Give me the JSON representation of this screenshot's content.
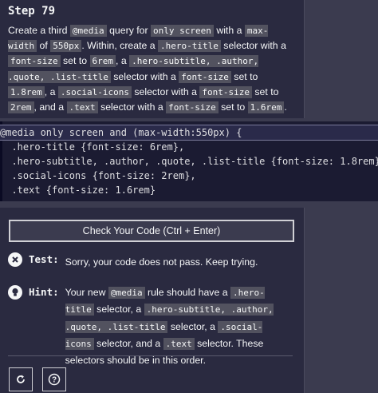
{
  "step": {
    "title": "Step 79"
  },
  "description": {
    "t1": "Create a third ",
    "c1": "@media",
    "t2": " query for ",
    "c2": "only screen",
    "t3": " with a ",
    "c3": "max-width",
    "t4": " of ",
    "c4": "550px",
    "t5": ". Within, create a ",
    "c5": ".hero-title",
    "t6": " selector with a ",
    "c6": "font-size",
    "t7": " set to ",
    "c7": "6rem",
    "t8": ", a ",
    "c8": ".hero-subtitle, .author, .quote, .list-title",
    "t9": " selector with a ",
    "c9": "font-size",
    "t10": " set to ",
    "c10": "1.8rem",
    "t11": ", a ",
    "c11": ".social-icons",
    "t12": " selector with a ",
    "c12": "font-size",
    "t13": " set to ",
    "c13": "2rem",
    "t14": ", and a ",
    "c14": ".text",
    "t15": " selector with a ",
    "c15": "font-size",
    "t16": " set to ",
    "c16": "1.6rem",
    "t17": "."
  },
  "editor": {
    "lines": [
      "@media only screen and (max-width:550px) {",
      "  .hero-title {font-size: 6rem},",
      "  .hero-subtitle, .author, .quote, .list-title {font-size: 1.8rem},",
      "  .social-icons {font-size: 2rem},",
      "  .text {font-size: 1.6rem}"
    ]
  },
  "check_button": {
    "label": "Check Your Code (Ctrl + Enter)"
  },
  "test": {
    "label": "Test:",
    "message": "Sorry, your code does not pass. Keep trying."
  },
  "hint": {
    "label": "Hint:",
    "t1": "Your new ",
    "c1": "@media",
    "t2": " rule should have a ",
    "c2": ".hero-title",
    "t3": " selector, a ",
    "c3": ".hero-subtitle, .author, .quote, .list-title",
    "t4": " selector, a ",
    "c4": ".social-icons",
    "t5": " selector, and a ",
    "c5": ".text",
    "t6": " selector. These selectors should be in this order."
  },
  "icons": {
    "reset": "reset-icon",
    "help": "help-icon",
    "test_status": "x-circle-icon",
    "hint": "lightbulb-icon"
  },
  "colors": {
    "panel": "#2a2a40",
    "editor_bg": "#1b1b32",
    "page_bg": "#3b3b4f",
    "inline_code_bg": "#52525f"
  }
}
